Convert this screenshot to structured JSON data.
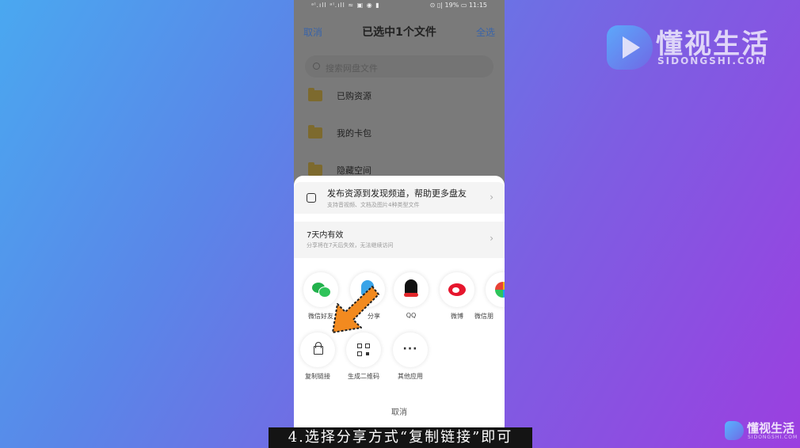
{
  "watermark": {
    "title": "懂视生活",
    "subtitle": "SIDONGSHI.COM"
  },
  "status_bar": {
    "left": "ᵃˡ.ıll ᵃˡ.ıll ≈ ▣ ◉ ▮",
    "right": "⊙ ▯| 19% ▭ 11:15"
  },
  "navbar": {
    "cancel": "取消",
    "title": "已选中1个文件",
    "select_all": "全选"
  },
  "search": {
    "placeholder": "搜索网盘文件"
  },
  "files": [
    {
      "name": "已购资源",
      "icon": "folder-icon"
    },
    {
      "name": "我的卡包",
      "icon": "folder-icon"
    },
    {
      "name": "隐藏空间",
      "icon": "folder-icon"
    }
  ],
  "share_sheet": {
    "publish": {
      "title": "发布资源到发现频道，帮助更多盘友",
      "subtitle": "支持音视频、文档及图片4种类型文件"
    },
    "validity": {
      "title": "7天内有效",
      "subtitle": "分享将在7天后失效，无法继续访问"
    },
    "row1": [
      {
        "label": "微信好友",
        "icon": "wechat-icon"
      },
      {
        "label": "分享",
        "icon": "share-blue-icon"
      },
      {
        "label": "QQ",
        "icon": "qq-icon"
      },
      {
        "label": "微博",
        "icon": "weibo-icon"
      },
      {
        "label": "微信朋",
        "icon": "moments-icon"
      }
    ],
    "row2": [
      {
        "label": "复制链接",
        "icon": "lock-icon"
      },
      {
        "label": "生成二维码",
        "icon": "qr-icon"
      },
      {
        "label": "其他应用",
        "icon": "more-icon",
        "glyph": "···"
      }
    ],
    "cancel": "取消"
  },
  "caption": "4.选择分享方式“复制链接”即可",
  "corner_logo": {
    "title": "懂视生活",
    "subtitle": "SIDONGSHI.COM"
  },
  "colors": {
    "arrow": "#f28a1f",
    "link_blue": "#3a64a8",
    "caption_bg": "#141414"
  }
}
